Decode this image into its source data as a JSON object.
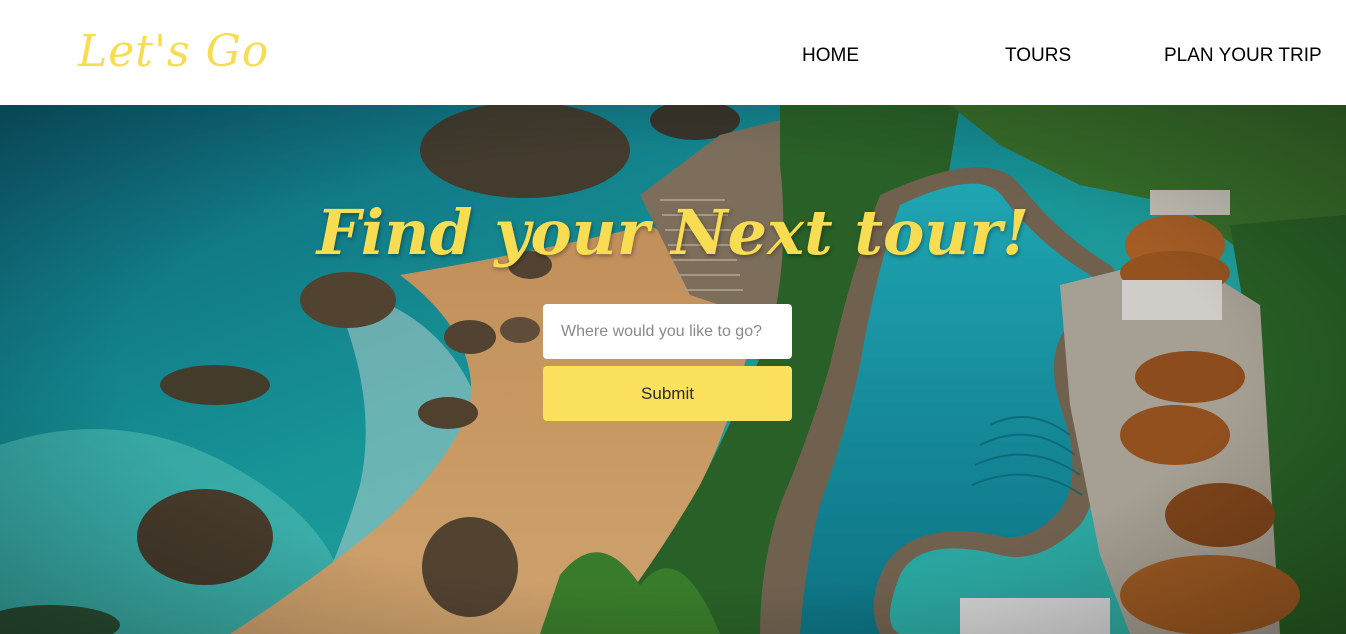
{
  "header": {
    "logo_text": "Let's Go",
    "nav": [
      {
        "label": "HOME"
      },
      {
        "label": "TOURS"
      },
      {
        "label": "PLAN YOUR TRIP"
      }
    ]
  },
  "hero": {
    "title": "Find your Next tour!",
    "search": {
      "value": "",
      "placeholder": "Where would you like to go?"
    },
    "submit_label": "Submit",
    "background_image": "aerial view of turquoise sea, sandy beach with rocks, stairs and cliffside resort with winding infinity pool and umbrellas"
  },
  "colors": {
    "accent_yellow": "#f8dc52",
    "button_yellow": "#fbe15e",
    "header_bg": "#ffffff",
    "nav_text": "#000000"
  }
}
